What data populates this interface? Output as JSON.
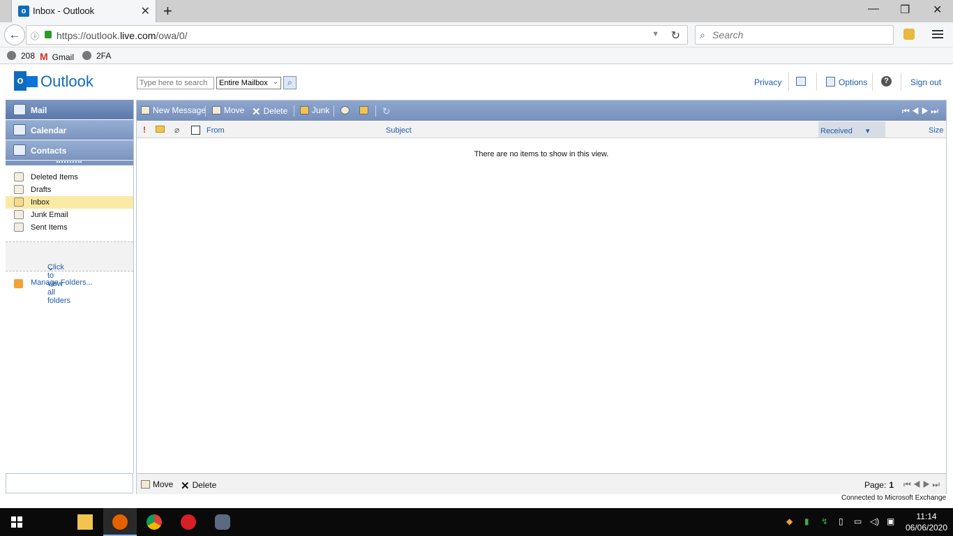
{
  "browser": {
    "tab_title": "Inbox - Outlook",
    "url_prefix": "https://outlook.",
    "url_domain": "live.com",
    "url_suffix": "/owa/0/",
    "search_placeholder": "Search",
    "bookmarks": [
      "208",
      "Gmail",
      "2FA"
    ]
  },
  "header": {
    "logo_text": "Outlook",
    "search_placeholder": "Type here to search",
    "search_scope": "Entire Mailbox",
    "links": {
      "privacy": "Privacy",
      "options": "Options",
      "help": "?",
      "signout": "Sign out"
    }
  },
  "nav": {
    "mail": "Mail",
    "calendar": "Calendar",
    "contacts": "Contacts"
  },
  "folders": [
    {
      "label": "Deleted Items",
      "icon": "deleted-items-icon"
    },
    {
      "label": "Drafts",
      "icon": "drafts-icon"
    },
    {
      "label": "Inbox",
      "icon": "inbox-icon",
      "selected": true
    },
    {
      "label": "Junk Email",
      "icon": "junk-email-icon"
    },
    {
      "label": "Sent Items",
      "icon": "sent-items-icon"
    }
  ],
  "folder_actions": {
    "view_all": "Click to view all folders",
    "manage": "Manage Folders..."
  },
  "toolbar": {
    "new_message": "New Message",
    "move": "Move",
    "delete": "Delete",
    "junk": "Junk"
  },
  "columns": {
    "from": "From",
    "subject": "Subject",
    "received": "Received",
    "size": "Size"
  },
  "list": {
    "empty_message": "There are no items to show in this view."
  },
  "footer": {
    "move": "Move",
    "delete": "Delete",
    "page_label": "Page:",
    "page_number": "1",
    "status": "Connected to Microsoft Exchange"
  },
  "taskbar": {
    "time": "11:14",
    "date": "06/06/2020"
  },
  "colors": {
    "accent": "#0f6cbd",
    "toolbar": "#8ea6cd",
    "selected_folder": "#fbeaa6",
    "link": "#1f5da8"
  }
}
